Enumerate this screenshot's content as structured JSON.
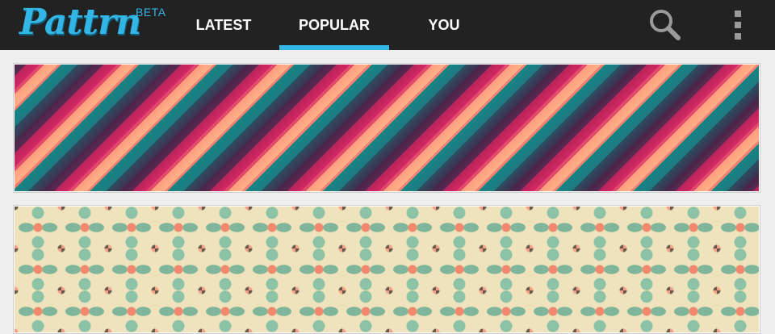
{
  "app": {
    "logo_text": "Pattrn",
    "badge": "BETA",
    "accent_color": "#33b5e5",
    "topbar_color": "#222222"
  },
  "tabs": [
    {
      "label": "LATEST",
      "selected": false
    },
    {
      "label": "POPULAR",
      "selected": true
    },
    {
      "label": "YOU",
      "selected": false
    }
  ],
  "actions": {
    "search_icon": "search-icon",
    "overflow_icon": "overflow-menu-icon"
  },
  "patterns": [
    {
      "kind": "diagonal-stripes",
      "colors": [
        "#4a2548",
        "#d42863",
        "#ffb08a",
        "#168486"
      ]
    },
    {
      "kind": "floral-damask",
      "colors": [
        "#efe3bd",
        "#7fb59a",
        "#f08a6c",
        "#6b5a4a"
      ]
    }
  ]
}
